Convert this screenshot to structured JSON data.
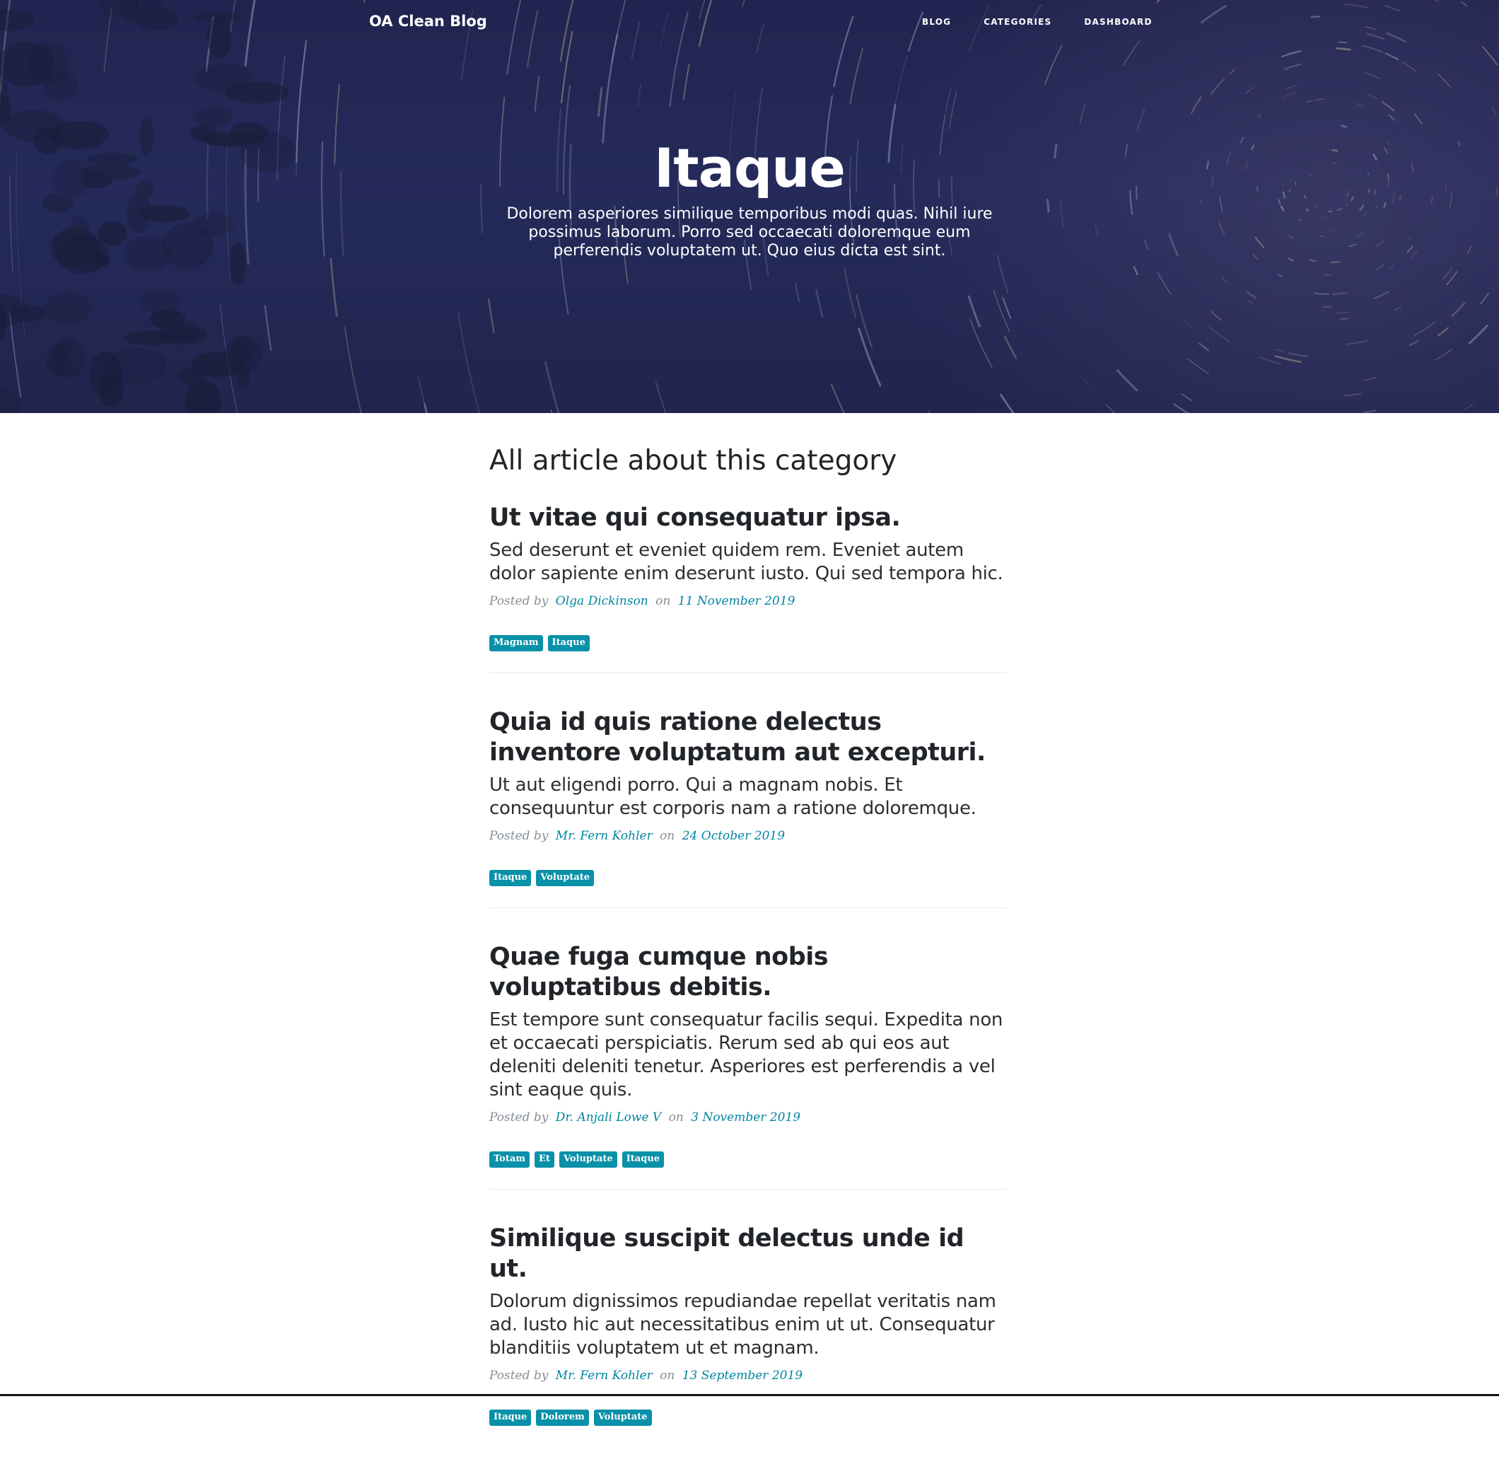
{
  "navbar": {
    "brand": "OA Clean Blog",
    "links": [
      "BLOG",
      "CATEGORIES",
      "DASHBOARD"
    ]
  },
  "hero": {
    "title": "Itaque",
    "subtitle": "Dolorem asperiores similique temporibus modi quas. Nihil iure possimus laborum. Porro sed occaecati doloremque eum perferendis voluptatem ut. Quo eius dicta est sint."
  },
  "section_title": "All article about this category",
  "posts": [
    {
      "title": "Ut vitae qui consequatur ipsa.",
      "subtitle": "Sed deserunt et eveniet quidem rem. Eveniet autem dolor sapiente enim deserunt iusto. Qui sed tempora hic.",
      "posted_by_label": "Posted by",
      "author": "Olga Dickinson",
      "on_label": "on",
      "date": "11 November 2019",
      "tags": [
        "Magnam",
        "Itaque"
      ]
    },
    {
      "title": "Quia id quis ratione delectus inventore voluptatum aut excepturi.",
      "subtitle": "Ut aut eligendi porro. Qui a magnam nobis. Et consequuntur est corporis nam a ratione doloremque.",
      "posted_by_label": "Posted by",
      "author": "Mr. Fern Kohler",
      "on_label": "on",
      "date": "24 October 2019",
      "tags": [
        "Itaque",
        "Voluptate"
      ]
    },
    {
      "title": "Quae fuga cumque nobis voluptatibus debitis.",
      "subtitle": "Est tempore sunt consequatur facilis sequi. Expedita non et occaecati perspiciatis. Rerum sed ab qui eos aut deleniti deleniti tenetur. Asperiores est perferendis a vel sint eaque quis.",
      "posted_by_label": "Posted by",
      "author": "Dr. Anjali Lowe V",
      "on_label": "on",
      "date": "3 November 2019",
      "tags": [
        "Totam",
        "Et",
        "Voluptate",
        "Itaque"
      ]
    },
    {
      "title": "Similique suscipit delectus unde id ut.",
      "subtitle": "Dolorum dignissimos repudiandae repellat veritatis nam ad. Iusto hic aut necessitatibus enim ut ut. Consequatur blanditiis voluptatem ut et magnam.",
      "posted_by_label": "Posted by",
      "author": "Mr. Fern Kohler",
      "on_label": "on",
      "date": "13 September 2019",
      "tags": [
        "Itaque",
        "Dolorem",
        "Voluptate"
      ]
    }
  ],
  "colors": {
    "accent": "#0085a1",
    "tag_bg": "#0891a8",
    "hero_bg": "#2b3168",
    "text": "#212529",
    "meta": "#868e96"
  }
}
